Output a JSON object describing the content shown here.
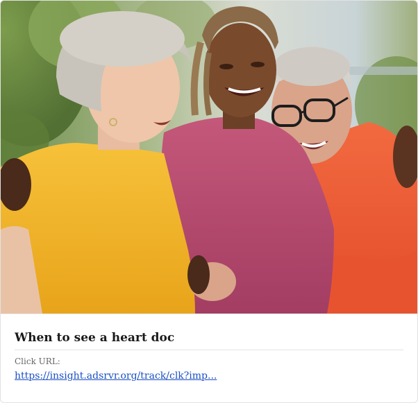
{
  "ad": {
    "headline": "When to see a heart doc",
    "click_url_label": "Click URL:",
    "click_url": "https://insight.adsrvr.org/track/clk?imp...",
    "image_icon": "photo-three-women-laughing-hug",
    "colors": {
      "link": "#1a4fc4",
      "headline": "#1a1a1a",
      "label": "#666666",
      "yellow_shirt": "#f2b324",
      "magenta_shirt": "#b44a6e",
      "orange_jacket": "#ee5a35"
    }
  }
}
